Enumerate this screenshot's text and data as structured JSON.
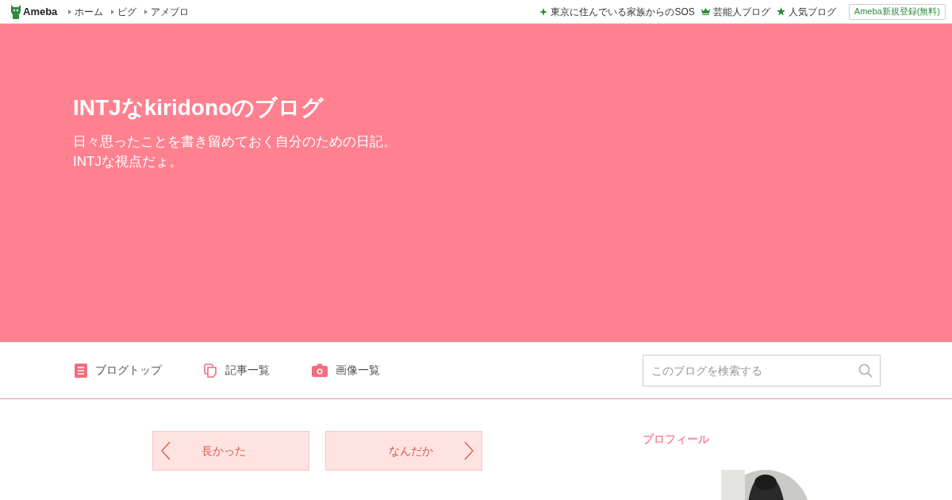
{
  "top_bar": {
    "logo": "Ameba",
    "links": [
      "ホーム",
      "ピグ",
      "アメブロ"
    ],
    "right_links": [
      "東京に住んでいる家族からのSOS",
      "芸能人ブログ",
      "人気ブログ"
    ],
    "signup_button": "Ameba新規登録(無料)"
  },
  "header": {
    "title": "INTJなkiridonoのブログ",
    "description": [
      "日々思ったことを書き留めておく自分のための日記。",
      "INTJな視点だょ。"
    ]
  },
  "nav": {
    "items": [
      "ブログトップ",
      "記事一覧",
      "画像一覧"
    ],
    "search": {
      "placeholder": "このブログを検索する"
    }
  },
  "pager": {
    "previous": "長かった",
    "next": "なんだか"
  },
  "sidebar": {
    "heading": "プロフィール"
  }
}
